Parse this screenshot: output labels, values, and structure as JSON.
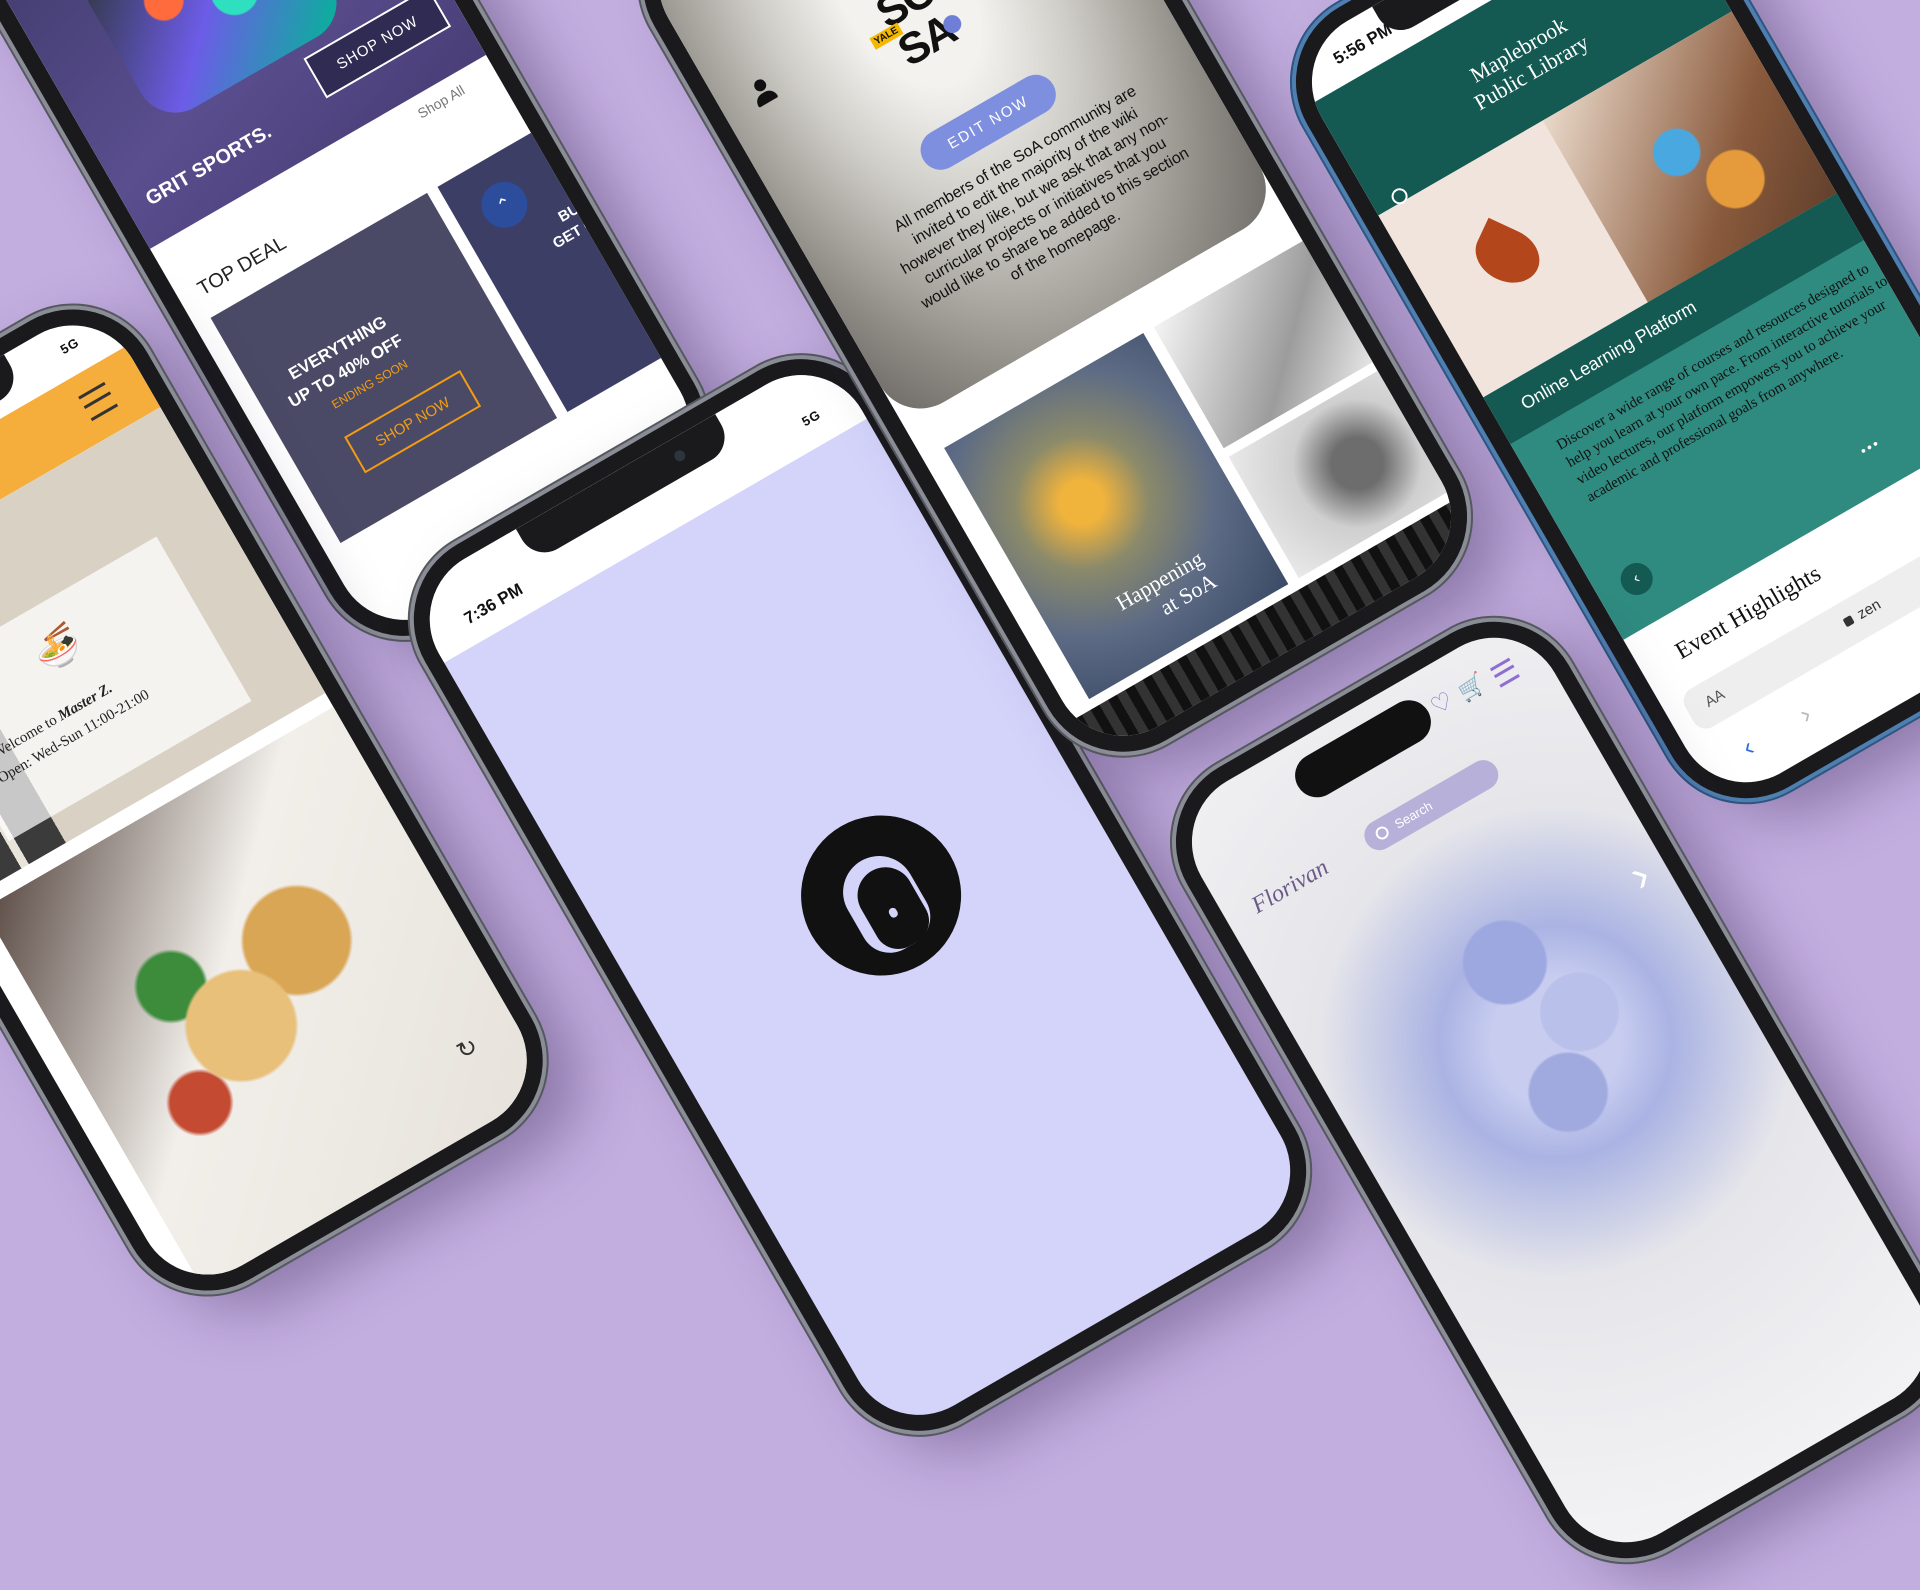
{
  "sports": {
    "hero_button": "SHOP NOW",
    "shop_all": "Shop All",
    "brand": "GRIT SPORTS.",
    "section_title": "TOP DEAL",
    "deal_line1": "EVERYTHING",
    "deal_line2": "UP TO 40% OFF",
    "deal_line3": "ENDING SOON",
    "deal_button": "SHOP NOW",
    "promo_line1": "BUY",
    "promo_line2": "GET ONE"
  },
  "restaurant": {
    "signal": "5G",
    "welcome_prefix": "Welcome to",
    "welcome_name": "Master Z.",
    "hours_label": "Open: Wed-Sun",
    "hours_time": "11:00-21:00"
  },
  "splash": {
    "time": "7:36 PM",
    "signal": "5G",
    "bg_color": "#d4d4fb"
  },
  "soa": {
    "logo_line1": "SO",
    "logo_line2": "SA",
    "logo_badge": "YALE",
    "edit_button": "EDIT NOW",
    "body": "All members of the SoA community are invited to edit the majority of the wiki however they like, but we ask that any non-curricular projects or initiatives that you would like to share be added to this section of the homepage.",
    "gallery_caption_line1": "Happening",
    "gallery_caption_line2": "at SoA"
  },
  "library": {
    "time": "5:56 PM",
    "title_line1": "Maplebrook",
    "title_line2": "Public Library",
    "card_title": "Online Learning Platform",
    "card_body": "Discover a wide range of courses and resources designed to help you learn at your own pace. From interactive tutorials to video lectures, our platform empowers you to achieve your academic and professional goals from anywhere.",
    "section_title": "Event Highlights",
    "url_text": "zen",
    "aa_label": "AA",
    "colors": {
      "teal_dark": "#145a53",
      "teal": "#2f8a80"
    }
  },
  "florist": {
    "brand": "Florivan",
    "search_placeholder": "Search"
  }
}
